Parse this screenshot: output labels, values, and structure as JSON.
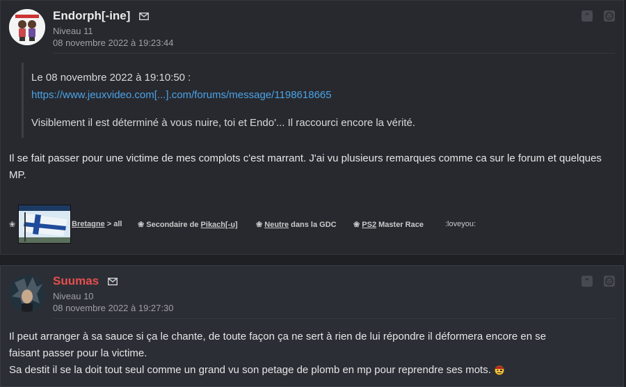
{
  "posts": [
    {
      "pseudo": "Endorph[-ine]",
      "level": "Niveau 11",
      "date": "08 novembre 2022 à 19:23:44",
      "quote": {
        "header": "Le 08 novembre 2022 à 19:10:50 :",
        "link": "https://www.jeuxvideo.com[...].com/forums/message/1198618665",
        "text": "Visiblement il est déterminé à vous nuire, toi et Endo'... Il raccourci encore la vérité."
      },
      "body": "Il se fait passer pour une victime de mes complots c'est marrant. J'ai vu plusieurs remarques comme ca sur le forum et quelques MP.",
      "signature": {
        "item1_link": "Bretagne",
        "item1_rest": " > all",
        "item2_prefix": "Secondaire de ",
        "item2_link": "Pikach[-u]",
        "item3_link": "Neutre",
        "item3_rest": " dans la GDC",
        "item4_link": "PS2",
        "item4_rest": " Master Race",
        "item5": ":loveyou:"
      }
    },
    {
      "pseudo": "Suumas",
      "level": "Niveau 10",
      "date": "08 novembre 2022 à 19:27:30",
      "body_line1": "Il peut arranger à sa sauce si ça le chante, de toute façon ça ne sert à rien de lui répondre il déformera encore en se",
      "body_line2": "faisant passer pour la victime.",
      "body_line3": "Sa destit il se la doit tout seul comme un grand vu son petage de plomb en mp pour reprendre ses mots."
    }
  ],
  "icons": {
    "quote": "quote-icon",
    "alert": "alert-icon",
    "mail": "mail-icon",
    "emoji": "pirate-emoji"
  },
  "colors": {
    "accent_red": "#e64f4f",
    "link_blue": "#4aa3e8"
  }
}
